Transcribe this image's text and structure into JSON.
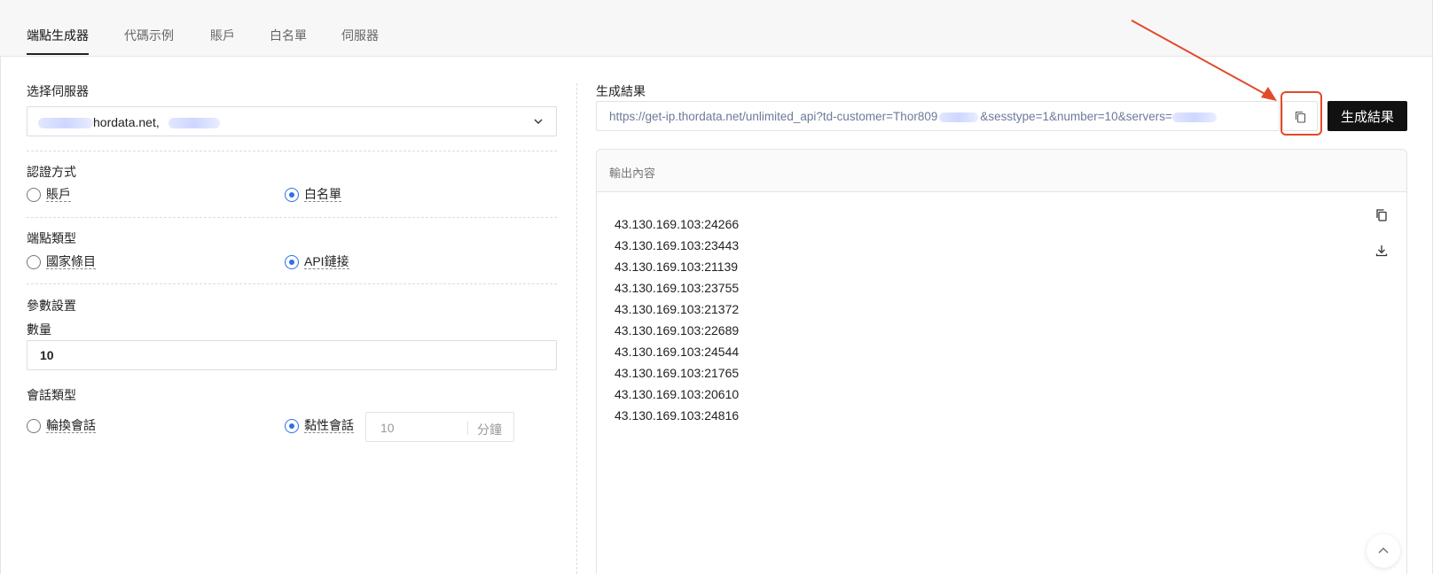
{
  "tabs": [
    {
      "label": "端點生成器",
      "active": true
    },
    {
      "label": "代碼示例",
      "active": false
    },
    {
      "label": "賬戶",
      "active": false
    },
    {
      "label": "白名單",
      "active": false
    },
    {
      "label": "伺服器",
      "active": false
    }
  ],
  "left": {
    "server_label": "选择伺服器",
    "server_value": "hordata.net,",
    "auth_label": "認證方式",
    "auth_options": [
      {
        "label": "賬戶",
        "checked": false
      },
      {
        "label": "白名單",
        "checked": true
      }
    ],
    "endpoint_label": "端點類型",
    "endpoint_options": [
      {
        "label": "國家條目",
        "checked": false
      },
      {
        "label": "API鏈接",
        "checked": true
      }
    ],
    "params_label": "參數設置",
    "quantity_label": "數量",
    "quantity_value": "10",
    "session_label": "會話類型",
    "session_options": [
      {
        "label": "輪換會話",
        "checked": false
      },
      {
        "label": "黏性會話",
        "checked": true
      }
    ],
    "sticky_minutes": "10",
    "sticky_unit": "分鐘"
  },
  "right": {
    "result_label": "生成結果",
    "url_part1": "https://get-ip.thordata.net/unlimited_api?td-customer=Thor809",
    "url_part2": "&sesstype=1&number=10&servers=",
    "generate_button": "生成結果",
    "output_title": "輸出內容",
    "output_lines": [
      "43.130.169.103:24266",
      "43.130.169.103:23443",
      "43.130.169.103:21139",
      "43.130.169.103:23755",
      "43.130.169.103:21372",
      "43.130.169.103:22689",
      "43.130.169.103:24544",
      "43.130.169.103:21765",
      "43.130.169.103:20610",
      "43.130.169.103:24816"
    ]
  },
  "icons": {
    "copy": "copy-icon",
    "download": "download-icon",
    "chevron": "chevron-down-icon",
    "scroll_top": "chevron-up-icon",
    "annotation_arrow": "arrow-annotation"
  },
  "colors": {
    "accent": "#2f6fe4",
    "annotation": "#e24a2a",
    "primary_button": "#111111"
  }
}
